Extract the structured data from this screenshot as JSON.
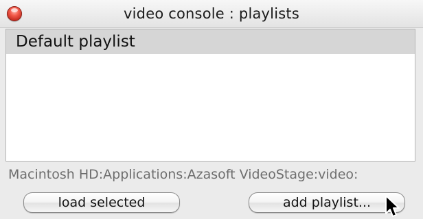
{
  "window": {
    "title": "video console : playlists"
  },
  "playlists": {
    "items": [
      {
        "label": "Default playlist",
        "selected": true
      }
    ]
  },
  "path_label": "Macintosh HD:Applications:Azasoft VideoStage:video:",
  "buttons": {
    "load_selected": "load selected",
    "add_playlist": "add playlist..."
  },
  "icons": {
    "close": "close-icon",
    "cursor": "mouse-pointer-icon"
  }
}
